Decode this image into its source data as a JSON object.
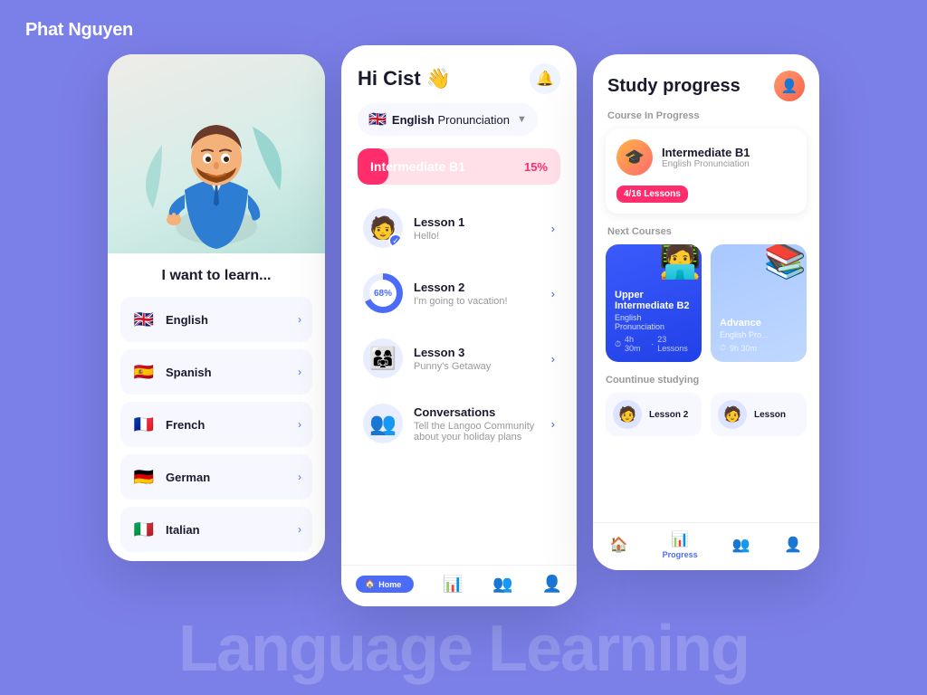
{
  "brand": {
    "title": "Phat Nguyen"
  },
  "watermark": {
    "text": "Language Learning"
  },
  "leftPhone": {
    "hero_emoji": "🧑‍💼",
    "title": "I want to learn...",
    "languages": [
      {
        "name": "English",
        "flag": "🇬🇧",
        "id": "english"
      },
      {
        "name": "Spanish",
        "flag": "🇪🇸",
        "id": "spanish"
      },
      {
        "name": "French",
        "flag": "🇫🇷",
        "id": "french"
      },
      {
        "name": "German",
        "flag": "🇩🇪",
        "id": "german"
      },
      {
        "name": "Italian",
        "flag": "🇮🇹",
        "id": "italian"
      }
    ]
  },
  "midPhone": {
    "greeting": "Hi Cist 👋",
    "bell_icon": "🔔",
    "course": {
      "flag": "🇬🇧",
      "name_bold": "English",
      "name_rest": " Pronunciation"
    },
    "progress": {
      "level": "Intermediate B1",
      "percent": "15%",
      "percent_num": 15
    },
    "lessons": [
      {
        "title": "Lesson 1",
        "subtitle": "Hello!",
        "type": "completed",
        "emoji": "🧑"
      },
      {
        "title": "Lesson 2",
        "subtitle": "I'm going to vacation!",
        "type": "progress",
        "progress": 68,
        "emoji": "🧑"
      },
      {
        "title": "Lesson 3",
        "subtitle": "Punny's Getaway",
        "type": "normal",
        "emoji": "👨‍👩‍👧"
      },
      {
        "title": "Conversations",
        "subtitle": "Tell the Langoo Community about your holiday plans",
        "type": "normal",
        "emoji": "👥"
      }
    ],
    "nav": [
      {
        "label": "Home",
        "icon": "🏠",
        "active": true
      },
      {
        "label": "Progress",
        "icon": "📊",
        "active": false
      },
      {
        "label": "Community",
        "icon": "👥",
        "active": false
      },
      {
        "label": "Profile",
        "icon": "👤",
        "active": false
      }
    ]
  },
  "rightPhone": {
    "title": "Study progress",
    "avatar_emoji": "👤",
    "course_in_progress": {
      "label": "Course In Progress",
      "course_emoji": "🎓",
      "title": "Intermediate B1",
      "subtitle": "English Pronunciation",
      "badge": "4/16 Lessons"
    },
    "next_courses": {
      "label": "Next Courses",
      "courses": [
        {
          "title": "Upper Intermediate B2",
          "subtitle": "English Pronunciation",
          "duration": "4h 30m",
          "lessons": "23 Lessons",
          "emoji": "🧑‍💻",
          "type": "blue"
        },
        {
          "title": "Advance",
          "subtitle": "English Pro...",
          "duration": "9h 30m",
          "emoji": "📚",
          "type": "light"
        }
      ]
    },
    "continue": {
      "label": "Countinue studying",
      "items": [
        {
          "title": "Lesson 2",
          "emoji": "🧑"
        },
        {
          "title": "Lesson",
          "emoji": "🧑"
        }
      ]
    },
    "nav": [
      {
        "label": "Home",
        "icon": "🏠",
        "active": false
      },
      {
        "label": "Progress",
        "icon": "📊",
        "active": true
      },
      {
        "label": "Community",
        "icon": "👥",
        "active": false
      },
      {
        "label": "Profile",
        "icon": "👤",
        "active": false
      }
    ]
  }
}
